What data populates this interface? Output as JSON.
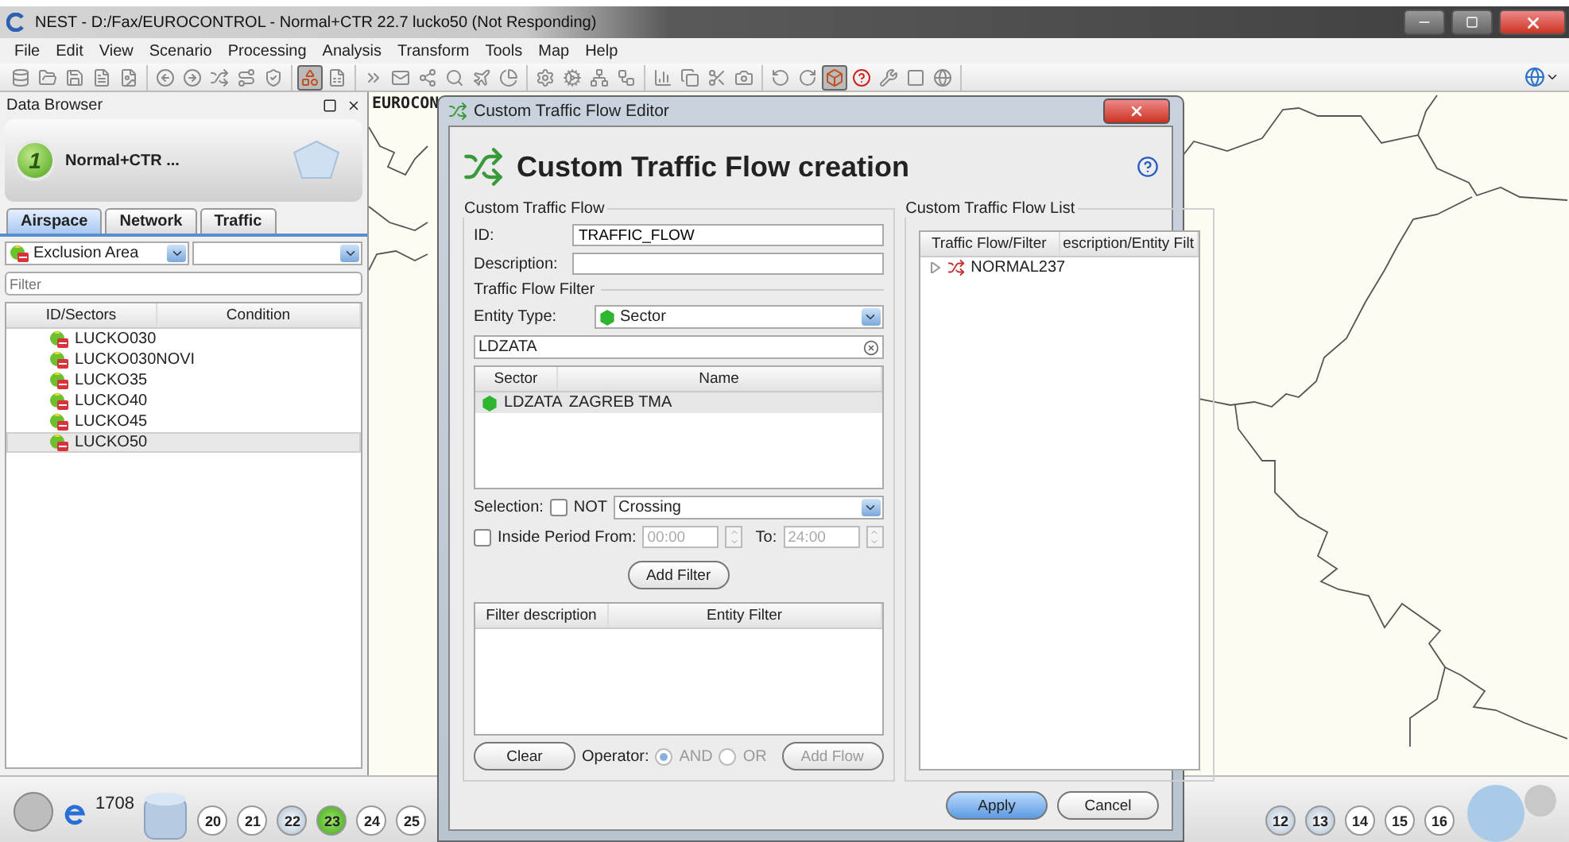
{
  "window": {
    "title": "NEST - D:/Fax/EUROCONTROL - Normal+CTR 22.7 lucko50 (Not Responding)"
  },
  "menu": [
    "File",
    "Edit",
    "View",
    "Scenario",
    "Processing",
    "Analysis",
    "Transform",
    "Tools",
    "Map",
    "Help"
  ],
  "toolbar": [
    [
      {
        "pressed": false
      },
      {
        "pressed": false
      },
      {
        "pressed": false
      },
      {
        "pressed": false
      },
      {
        "pressed": false
      }
    ],
    [
      {
        "pressed": false
      },
      {
        "pressed": false
      },
      {
        "pressed": false
      },
      {
        "pressed": false
      },
      {
        "pressed": false
      }
    ],
    [
      {
        "pressed": true
      },
      {
        "pressed": false
      }
    ],
    [
      {
        "pressed": false
      },
      {
        "pressed": false
      },
      {
        "pressed": false
      },
      {
        "pressed": false
      },
      {
        "pressed": false
      },
      {
        "pressed": false
      }
    ],
    [
      {
        "pressed": false
      },
      {
        "pressed": false
      },
      {
        "pressed": false
      },
      {
        "pressed": false
      }
    ],
    [
      {
        "pressed": false
      },
      {
        "pressed": false
      },
      {
        "pressed": false
      },
      {
        "pressed": false
      }
    ],
    [
      {
        "pressed": false
      },
      {
        "pressed": false
      },
      {
        "pressed": true
      },
      {
        "pressed": false
      },
      {
        "pressed": false
      },
      {
        "pressed": false
      },
      {
        "pressed": false
      }
    ]
  ],
  "data_browser": {
    "title": "Data Browser",
    "scenario_number": "1",
    "scenario": "Normal+CTR ...",
    "tabs": [
      {
        "label": "Airspace",
        "selected": true
      },
      {
        "label": "Network",
        "selected": false
      },
      {
        "label": "Traffic",
        "selected": false
      }
    ],
    "type_select": "Exclusion Area",
    "filter_placeholder": "Filter",
    "columns": [
      "ID/Sectors",
      "Condition"
    ],
    "rows": [
      {
        "name": "LUCKO030",
        "selected": false
      },
      {
        "name": "LUCKO030NOVI",
        "selected": false
      },
      {
        "name": "LUCKO35",
        "selected": false
      },
      {
        "name": "LUCKO40",
        "selected": false
      },
      {
        "name": "LUCKO45",
        "selected": false
      },
      {
        "name": "LUCKO50",
        "selected": true
      }
    ]
  },
  "map": {
    "label": "EUROCON"
  },
  "timeline": {
    "count": "1708",
    "days_left": [
      {
        "label": "20",
        "selected": false,
        "shaded": false
      },
      {
        "label": "21",
        "selected": false,
        "shaded": false
      },
      {
        "label": "22",
        "selected": false,
        "shaded": true
      },
      {
        "label": "23",
        "selected": true,
        "shaded": false
      },
      {
        "label": "24",
        "selected": false,
        "shaded": false
      },
      {
        "label": "25",
        "selected": false,
        "shaded": false
      }
    ],
    "days_right": [
      {
        "label": "12",
        "selected": false,
        "shaded": true
      },
      {
        "label": "13",
        "selected": false,
        "shaded": true
      },
      {
        "label": "14",
        "selected": false,
        "shaded": false
      },
      {
        "label": "15",
        "selected": false,
        "shaded": false
      },
      {
        "label": "16",
        "selected": false,
        "shaded": false
      }
    ]
  },
  "dialog": {
    "title": "Custom Traffic Flow Editor",
    "heading": "Custom Traffic Flow creation",
    "flow_group": "Custom Traffic Flow",
    "id_label": "ID:",
    "id_value": "TRAFFIC_FLOW",
    "description_label": "Description:",
    "filter_group": "Traffic Flow Filter",
    "entity_label": "Entity Type:",
    "entity_value": "Sector",
    "search_value": "LDZATA",
    "sector_columns": [
      "Sector",
      "Name"
    ],
    "sector_rows": [
      {
        "sector": "LDZATA",
        "name": "ZAGREB TMA",
        "selected": true
      }
    ],
    "selection_label": "Selection:",
    "not": {
      "label": "NOT",
      "checked": false
    },
    "selection_value": "Crossing",
    "inside_period": {
      "label": "Inside Period From:",
      "checked": false
    },
    "from_value": "00:00",
    "to_label": "To:",
    "to_value": "24:00",
    "add_filter": "Add Filter",
    "filter_columns": [
      "Filter description",
      "Entity Filter"
    ],
    "clear": "Clear",
    "operator_label": "Operator:",
    "operators": [
      {
        "label": "AND",
        "selected": true,
        "disabled": true
      },
      {
        "label": "OR",
        "selected": false,
        "disabled": true
      }
    ],
    "add_flow": {
      "label": "Add Flow",
      "disabled": true
    },
    "list_group": "Custom Traffic Flow List",
    "list_columns": [
      "Traffic Flow/Filter",
      "escription/Entity Filt"
    ],
    "flows": [
      {
        "label": "NORMAL237",
        "expanded": false
      }
    ],
    "buttons": [
      {
        "label": "Apply",
        "kind": "default"
      },
      {
        "label": "Cancel",
        "kind": "normal"
      }
    ]
  }
}
